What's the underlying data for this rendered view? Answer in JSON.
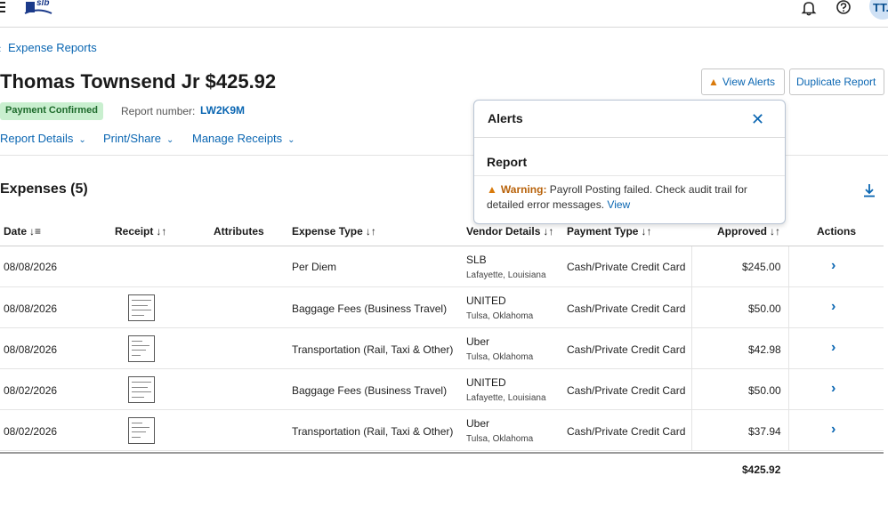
{
  "header": {
    "logo_text": "slb",
    "avatar_initials": "TT."
  },
  "nav": {
    "back_label": "Expense Reports"
  },
  "report": {
    "title": "Thomas Townsend Jr $425.92",
    "status": "Payment Confirmed",
    "report_number_label": "Report number:",
    "report_number": "LW2K9M"
  },
  "actions": {
    "view_alerts": "View Alerts",
    "duplicate": "Duplicate Report"
  },
  "menus": {
    "report_details": "Report Details",
    "print_share": "Print/Share",
    "manage_receipts": "Manage Receipts"
  },
  "alerts": {
    "title": "Alerts",
    "section": "Report",
    "warning_label": "Warning:",
    "message": "Payroll Posting failed. Check audit trail for detailed error messages.",
    "view_link": "View"
  },
  "expenses": {
    "title": "Expenses (5)",
    "columns": {
      "date": "Date",
      "receipt": "Receipt",
      "attributes": "Attributes",
      "expense_type": "Expense Type",
      "vendor": "Vendor Details",
      "payment_type": "Payment Type",
      "approved": "Approved",
      "actions": "Actions"
    },
    "rows": [
      {
        "date": "08/08/2026",
        "expense_type": "Per Diem",
        "vendor": "SLB",
        "location": "Lafayette, Louisiana",
        "payment": "Cash/Private Credit Card",
        "approved": "$245.00"
      },
      {
        "date": "08/08/2026",
        "expense_type": "Baggage Fees (Business Travel)",
        "vendor": "UNITED",
        "location": "Tulsa, Oklahoma",
        "payment": "Cash/Private Credit Card",
        "approved": "$50.00"
      },
      {
        "date": "08/08/2026",
        "expense_type": "Transportation (Rail, Taxi & Other)",
        "vendor": "Uber",
        "location": "Tulsa, Oklahoma",
        "payment": "Cash/Private Credit Card",
        "approved": "$42.98"
      },
      {
        "date": "08/02/2026",
        "expense_type": "Baggage Fees (Business Travel)",
        "vendor": "UNITED",
        "location": "Lafayette, Louisiana",
        "payment": "Cash/Private Credit Card",
        "approved": "$50.00"
      },
      {
        "date": "08/02/2026",
        "expense_type": "Transportation (Rail, Taxi & Other)",
        "vendor": "Uber",
        "location": "Tulsa, Oklahoma",
        "payment": "Cash/Private Credit Card",
        "approved": "$37.94"
      }
    ],
    "total": "$425.92"
  },
  "icons": {
    "menu": "hamburger-icon",
    "notifications": "bell-icon",
    "help": "help-icon",
    "download": "download-icon",
    "warning": "warning-icon",
    "close": "close-icon",
    "row_action": "chevron-right-icon"
  },
  "colors": {
    "accent": "#0a66b2",
    "warning": "#d97a0b",
    "success_bg": "#c9efcf"
  }
}
